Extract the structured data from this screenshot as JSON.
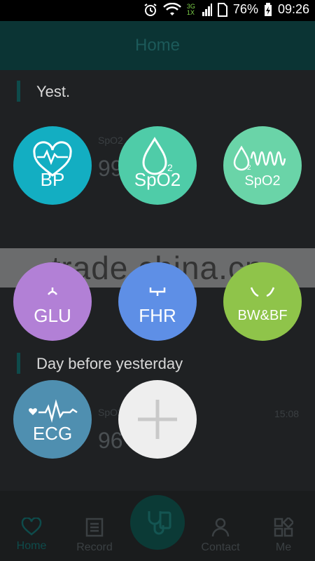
{
  "status_bar": {
    "network": "3G 1X",
    "battery_percent": "76%",
    "time": "09:26"
  },
  "header": {
    "title": "Home"
  },
  "sections": {
    "yesterday": "Yest.",
    "day_before": "Day before yesterday"
  },
  "faint_cards": {
    "card1_label": "SpO2",
    "card1_value": "99",
    "card2_label": "SpO2",
    "card2_value": "96",
    "card2_time": "15:08"
  },
  "watermark": "trade.china.cn",
  "devices": [
    {
      "id": "bp",
      "label": "BP",
      "color": "#13aec2",
      "icon": "heart-pulse-icon"
    },
    {
      "id": "spo2",
      "label": "SpO2",
      "color": "#4fcca8",
      "icon": "drop-o2-icon"
    },
    {
      "id": "spo2w",
      "label": "SpO2",
      "color": "#6ad4a8",
      "icon": "drop-wave-icon"
    },
    {
      "id": "glu",
      "label": "GLU",
      "color": "#b280d6",
      "icon": "glucose-icon"
    },
    {
      "id": "fhr",
      "label": "FHR",
      "color": "#5e8fe6",
      "icon": "fetal-monitor-icon"
    },
    {
      "id": "bwbf",
      "label": "BW&BF",
      "color": "#8fc44a",
      "icon": "feet-icon"
    },
    {
      "id": "ecg",
      "label": "ECG",
      "color": "#4f8fb0",
      "icon": "ecg-icon"
    }
  ],
  "nav": {
    "home": "Home",
    "record": "Record",
    "contact": "Contact",
    "me": "Me"
  }
}
